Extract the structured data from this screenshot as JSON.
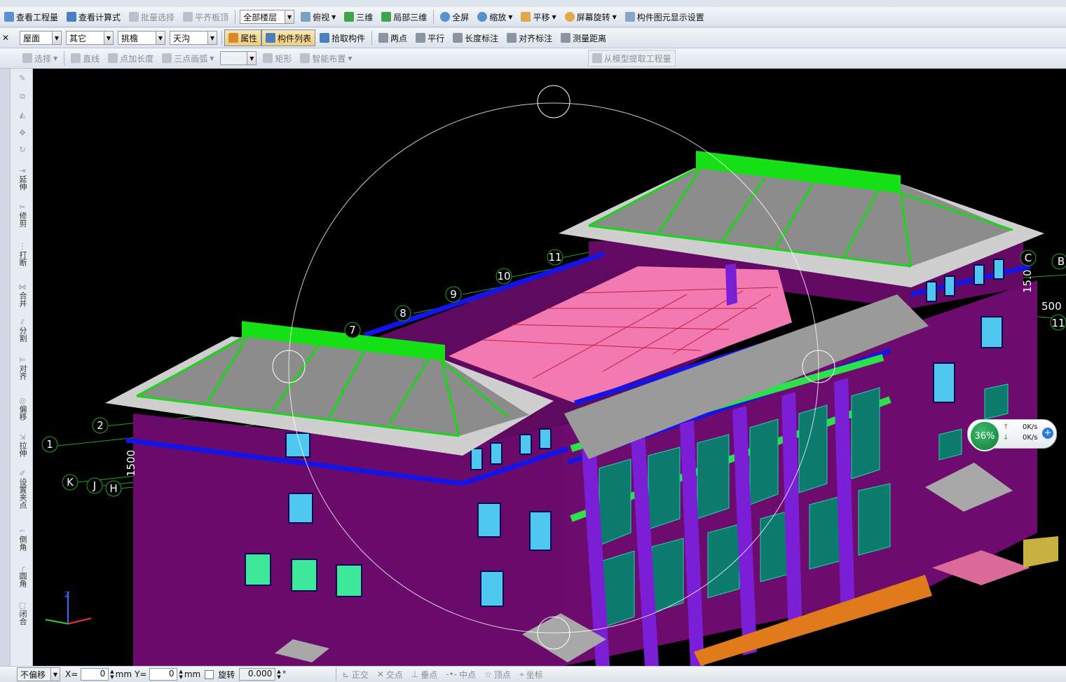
{
  "toolbar1": {
    "items": [
      {
        "label": "查看工程量",
        "icon": "quantity-icon",
        "disabled": false
      },
      {
        "label": "查看计算式",
        "icon": "formula-icon",
        "disabled": false
      },
      {
        "label": "批量选择",
        "icon": "batch-select-icon",
        "disabled": true
      },
      {
        "label": "平齐板顶",
        "icon": "align-slab-icon",
        "disabled": true
      }
    ],
    "floor_select": "全部楼层",
    "view_items": [
      {
        "label": "俯视",
        "icon": "top-view-icon",
        "dropdown": true
      },
      {
        "label": "三维",
        "icon": "3d-icon",
        "dropdown": false
      },
      {
        "label": "局部三维",
        "icon": "local-3d-icon",
        "dropdown": false
      },
      {
        "label": "全屏",
        "icon": "fullscreen-icon",
        "dropdown": false
      },
      {
        "label": "缩放",
        "icon": "zoom-icon",
        "dropdown": true
      },
      {
        "label": "平移",
        "icon": "pan-icon",
        "dropdown": true
      },
      {
        "label": "屏幕旋转",
        "icon": "rotate-screen-icon",
        "dropdown": true
      },
      {
        "label": "构件图元显示设置",
        "icon": "display-settings-icon",
        "dropdown": false
      }
    ]
  },
  "toolbar2": {
    "combos": [
      "屋面",
      "其它",
      "挑檐",
      "天沟"
    ],
    "items": [
      {
        "label": "属性",
        "icon": "property-icon",
        "active": true
      },
      {
        "label": "构件列表",
        "icon": "component-list-icon",
        "active": true
      },
      {
        "label": "拾取构件",
        "icon": "pick-icon",
        "active": false
      },
      {
        "label": "两点",
        "icon": "two-point-icon",
        "active": false
      },
      {
        "label": "平行",
        "icon": "parallel-icon",
        "active": false
      },
      {
        "label": "长度标注",
        "icon": "length-dim-icon",
        "active": false
      },
      {
        "label": "对齐标注",
        "icon": "align-dim-icon",
        "active": false
      },
      {
        "label": "测量距离",
        "icon": "measure-icon",
        "active": false
      }
    ]
  },
  "toolbar3": {
    "items": [
      {
        "label": "选择",
        "icon": "select-icon",
        "dropdown": true
      },
      {
        "label": "直线",
        "icon": "line-icon",
        "dropdown": false
      },
      {
        "label": "点加长度",
        "icon": "point-length-icon",
        "dropdown": false
      },
      {
        "label": "三点画弧",
        "icon": "arc-icon",
        "dropdown": true
      },
      {
        "label": "矩形",
        "icon": "rectangle-icon",
        "dropdown": false
      },
      {
        "label": "智能布置",
        "icon": "smart-layout-icon",
        "dropdown": true
      }
    ],
    "extract_label": "从模型提取工程量"
  },
  "left_tools": [
    {
      "label": "延伸",
      "icon": "extend-icon"
    },
    {
      "label": "修剪",
      "icon": "trim-icon"
    },
    {
      "label": "打断",
      "icon": "break-icon"
    },
    {
      "label": "合并",
      "icon": "merge-icon"
    },
    {
      "label": "分割",
      "icon": "split-icon"
    },
    {
      "label": "对齐",
      "icon": "align-icon"
    },
    {
      "label": "偏移",
      "icon": "offset-icon"
    },
    {
      "label": "拉伸",
      "icon": "stretch-icon"
    },
    {
      "label": "设置夹点",
      "icon": "grip-icon"
    },
    {
      "label": "倒角",
      "icon": "chamfer-icon"
    },
    {
      "label": "圆角",
      "icon": "fillet-icon"
    },
    {
      "label": "闭合",
      "icon": "close-icon"
    }
  ],
  "viewport": {
    "axis_labels": [
      "1",
      "2",
      "7",
      "8",
      "9",
      "10",
      "11",
      "K",
      "J",
      "H",
      "C",
      "B",
      "11"
    ],
    "dim_labels": [
      "1500",
      "15.0",
      "500"
    ],
    "colors": {
      "wall": "#6a0a6a",
      "roof": "#8c8c8c",
      "ridge": "#19d619",
      "slab": "#f27ab0",
      "beam": "#1414e6",
      "column": "#7a1fd6",
      "glass": "#0d7a6e"
    }
  },
  "network_widget": {
    "percent": "36%",
    "up": "0K/s",
    "down": "0K/s"
  },
  "status": {
    "offset_mode": "不偏移",
    "x_label": "X=",
    "x_value": "0",
    "x_unit": "mm",
    "y_label": "Y=",
    "y_value": "0",
    "y_unit": "mm",
    "rotate_label": "旋转",
    "rotate_value": "0.000",
    "rotate_unit": "°",
    "snap_items": [
      {
        "label": "正交",
        "icon": "ortho-icon"
      },
      {
        "label": "交点",
        "icon": "intersection-icon"
      },
      {
        "label": "垂点",
        "icon": "perpendicular-icon"
      },
      {
        "label": "中点",
        "icon": "midpoint-icon"
      },
      {
        "label": "顶点",
        "icon": "vertex-icon"
      },
      {
        "label": "坐标",
        "icon": "coordinate-icon"
      }
    ]
  }
}
